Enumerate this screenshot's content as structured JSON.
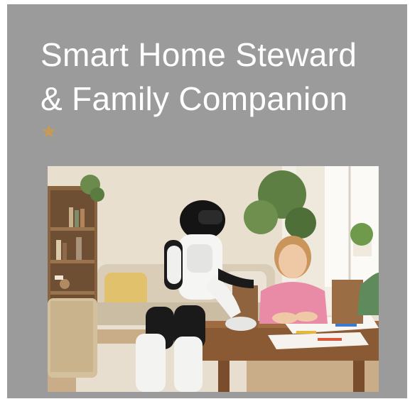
{
  "card": {
    "title_line1": "Smart Home Steward",
    "title_line2": "& Family Companion",
    "decoration_icon": "star-icon",
    "accent_color": "#c89a56",
    "background_color": "#9b9b9b"
  },
  "image": {
    "alt": ""
  }
}
